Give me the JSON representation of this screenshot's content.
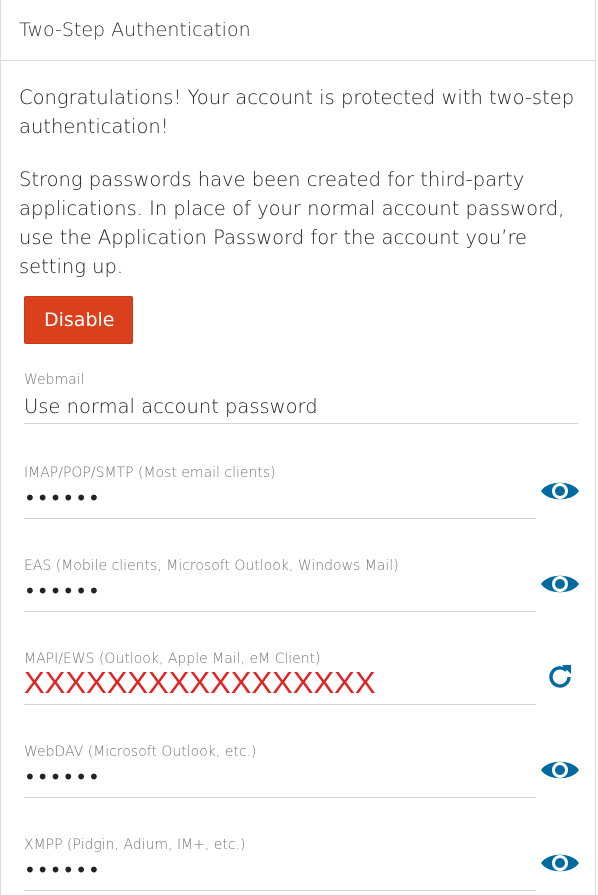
{
  "header": {
    "title": "Two-Step Authentication"
  },
  "intro": {
    "congrats": "Congratulations! Your account is protected with two-step authentication!",
    "info": "Strong passwords have been created for third-party applications. In place of your normal account password, use the Application Password for the account you’re setting up."
  },
  "actions": {
    "disable_label": "Disable"
  },
  "webmail": {
    "label": "Webmail",
    "value": "Use normal account password"
  },
  "passwords": [
    {
      "label": "IMAP/POP/SMTP (Most email clients)",
      "value": "••••••",
      "icon": "eye-icon"
    },
    {
      "label": "EAS (Mobile clients, Microsoft Outlook, Windows Mail)",
      "value": "••••••",
      "icon": "eye-icon"
    },
    {
      "label": "MAPI/EWS (Outlook, Apple Mail, eM Client)",
      "value": "XXXXXXXXXXXXXXXXX",
      "icon": "refresh-icon"
    },
    {
      "label": "WebDAV (Microsoft Outlook, etc.)",
      "value": "••••••",
      "icon": "eye-icon"
    },
    {
      "label": "XMPP (Pidgin, Adium, IM+, etc.)",
      "value": "••••••",
      "icon": "eye-icon"
    }
  ],
  "colors": {
    "accent": "#006aa0",
    "danger_button": "#d9401b",
    "redacted_text": "#e02424"
  }
}
